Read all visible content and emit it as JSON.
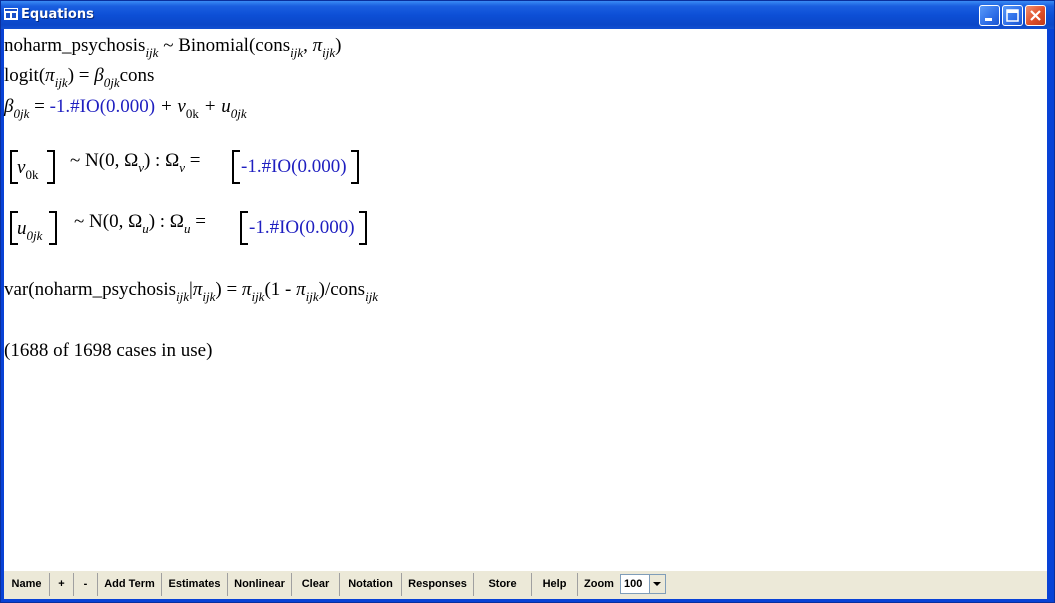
{
  "window": {
    "title": "Equations"
  },
  "equations": {
    "line1": {
      "lhs": "noharm_psychosis",
      "lhs_sub": "ijk",
      "dist": "~ Binomial(cons",
      "cons_sub": "ijk",
      "comma": ", ",
      "pi": "π",
      "pi_sub": "ijk",
      "close": ")"
    },
    "line2": {
      "logit": "logit(",
      "pi": "π",
      "pi_sub": "ijk",
      "eq": ") = ",
      "beta": "β",
      "beta_sub": "0jk",
      "cons": "cons"
    },
    "line3": {
      "beta": "β",
      "beta_sub": "0jk",
      "eq": " = ",
      "estimate": "-1.#IO(0.000)",
      "plus_v": " + v",
      "v_sub": "0k",
      "plus_u": " + u",
      "u_sub": "0jk"
    },
    "line4": {
      "v": "v",
      "v_sub": "0k",
      "dist": "~ N(0,  Ω",
      "omega_sub": "v",
      "sep": ")  :  Ω",
      "omega_sub2": "v",
      "eq": " =",
      "estimate": "-1.#IO(0.000)"
    },
    "line5": {
      "u": "u",
      "u_sub": "0jk",
      "dist": "~ N(0,  Ω",
      "omega_sub": "u",
      "sep": ")  :  Ω",
      "omega_sub2": "u",
      "eq": " =",
      "estimate": "-1.#IO(0.000)"
    },
    "line6": {
      "var": "var(noharm_psychosis",
      "sub1": "ijk",
      "bar": "|",
      "pi": "π",
      "pi_sub": "ijk",
      "eq": ") = ",
      "pi2": "π",
      "pi2_sub": "ijk",
      "mid": "(1 - ",
      "pi3": "π",
      "pi3_sub": "ijk",
      "end": ")/cons",
      "cons_sub": "ijk"
    },
    "cases": "(1688 of 1698 cases in use)"
  },
  "toolbar": {
    "buttons": [
      {
        "id": "name",
        "label": "Name"
      },
      {
        "id": "plus",
        "label": "+"
      },
      {
        "id": "minus",
        "label": "-"
      },
      {
        "id": "add-term",
        "label": "Add Term"
      },
      {
        "id": "estimates",
        "label": "Estimates"
      },
      {
        "id": "nonlinear",
        "label": "Nonlinear"
      },
      {
        "id": "clear",
        "label": "Clear"
      },
      {
        "id": "notation",
        "label": "Notation"
      },
      {
        "id": "responses",
        "label": "Responses"
      },
      {
        "id": "store",
        "label": "Store"
      },
      {
        "id": "help",
        "label": "Help"
      }
    ],
    "zoom_label": "Zoom",
    "zoom_value": "100"
  },
  "colors": {
    "estimate": "#1f1fc0",
    "titlebar": "#0b47c8"
  }
}
